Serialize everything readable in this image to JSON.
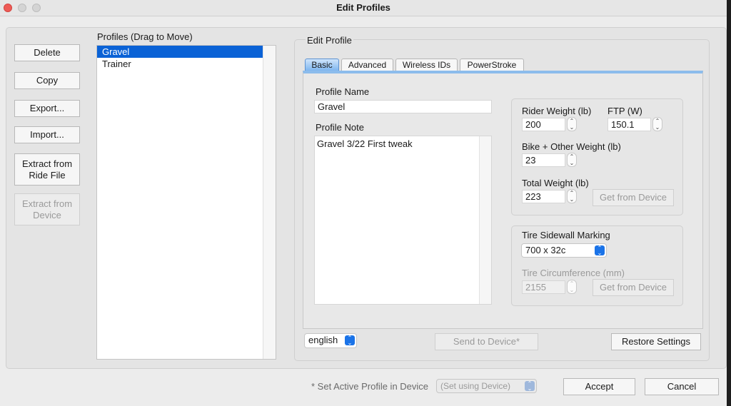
{
  "window": {
    "title": "Edit Profiles"
  },
  "left_buttons": {
    "delete": "Delete",
    "copy": "Copy",
    "export": "Export...",
    "import": "Import...",
    "extract_ride_file": "Extract from Ride File",
    "extract_device": "Extract from Device"
  },
  "profiles": {
    "label": "Profiles (Drag to Move)",
    "items": [
      "Gravel",
      "Trainer"
    ],
    "selected": "Gravel"
  },
  "edit_profile": {
    "label": "Edit Profile",
    "tabs": [
      "Basic",
      "Advanced",
      "Wireless IDs",
      "PowerStroke"
    ],
    "active_tab": "Basic",
    "profile_name_label": "Profile Name",
    "profile_name": "Gravel",
    "profile_note_label": "Profile Note",
    "profile_note": "Gravel 3/22  First tweak",
    "rider_weight_label": "Rider Weight (lb)",
    "rider_weight": "200",
    "ftp_label": "FTP (W)",
    "ftp": "150.1",
    "bike_weight_label": "Bike + Other Weight (lb)",
    "bike_weight": "23",
    "total_weight_label": "Total Weight (lb)",
    "total_weight": "223",
    "get_from_device": "Get from Device",
    "tire_label": "Tire Sidewall Marking",
    "tire": "700 x 32c",
    "tire_circ_label": "Tire Circumference (mm)",
    "tire_circ": "2155",
    "language": "english",
    "send_to_device": "Send to Device*",
    "restore_settings": "Restore Settings"
  },
  "footer": {
    "active_profile_label": "* Set Active Profile in Device",
    "active_profile_select": "(Set using Device)",
    "accept": "Accept",
    "cancel": "Cancel"
  }
}
